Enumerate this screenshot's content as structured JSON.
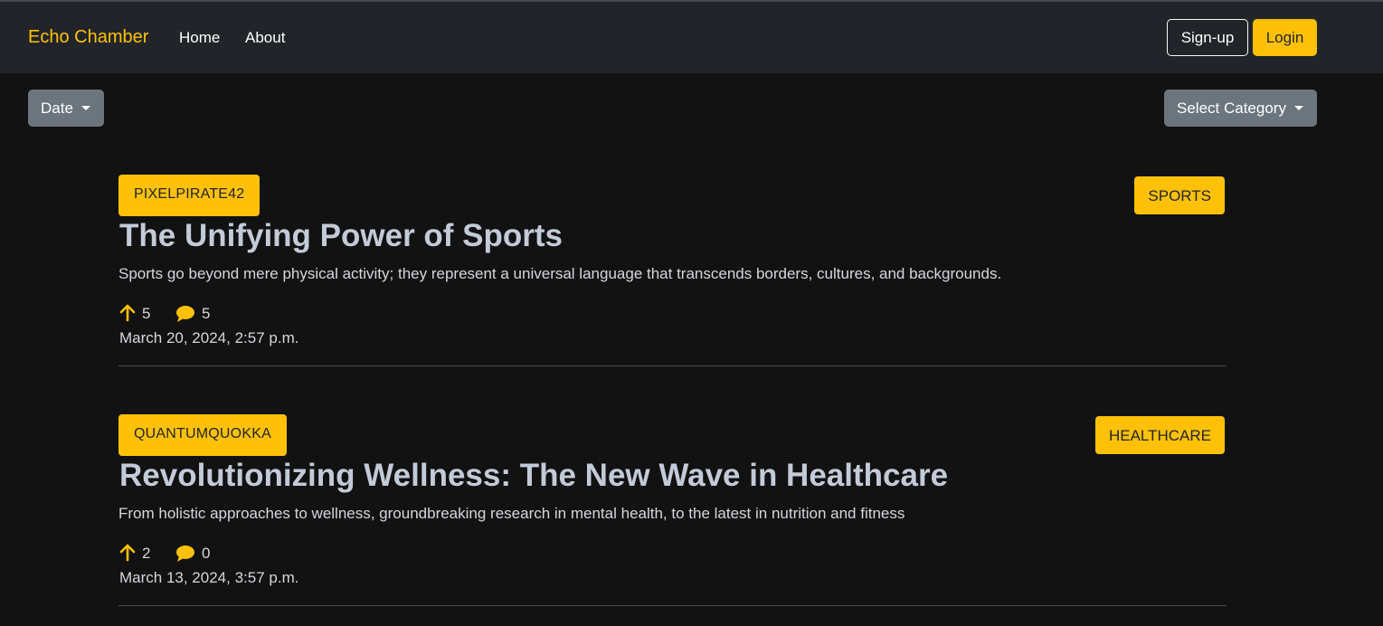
{
  "navbar": {
    "brand": "Echo Chamber",
    "links": [
      "Home",
      "About"
    ],
    "signup_label": "Sign-up",
    "login_label": "Login"
  },
  "filters": {
    "date_label": "Date",
    "category_label": "Select Category"
  },
  "colors": {
    "accent": "#ffc107",
    "navbar_bg": "#212529",
    "page_bg": "#121212",
    "secondary_button": "#6c757d"
  },
  "posts": [
    {
      "author": "PIXELPIRATE42",
      "category": "SPORTS",
      "title": "The Unifying Power of Sports",
      "summary": "Sports go beyond mere physical activity; they represent a universal language that transcends borders, cultures, and backgrounds.",
      "upvotes": "5",
      "comments": "5",
      "date": "March 20, 2024, 2:57 p.m."
    },
    {
      "author": "QUANTUMQUOKKA",
      "category": "HEALTHCARE",
      "title": "Revolutionizing Wellness: The New Wave in Healthcare",
      "summary": "From holistic approaches to wellness, groundbreaking research in mental health, to the latest in nutrition and fitness",
      "upvotes": "2",
      "comments": "0",
      "date": "March 13, 2024, 3:57 p.m."
    }
  ],
  "icons": {
    "upvote": "arrow-up-icon",
    "comment": "speech-bubble-icon"
  }
}
